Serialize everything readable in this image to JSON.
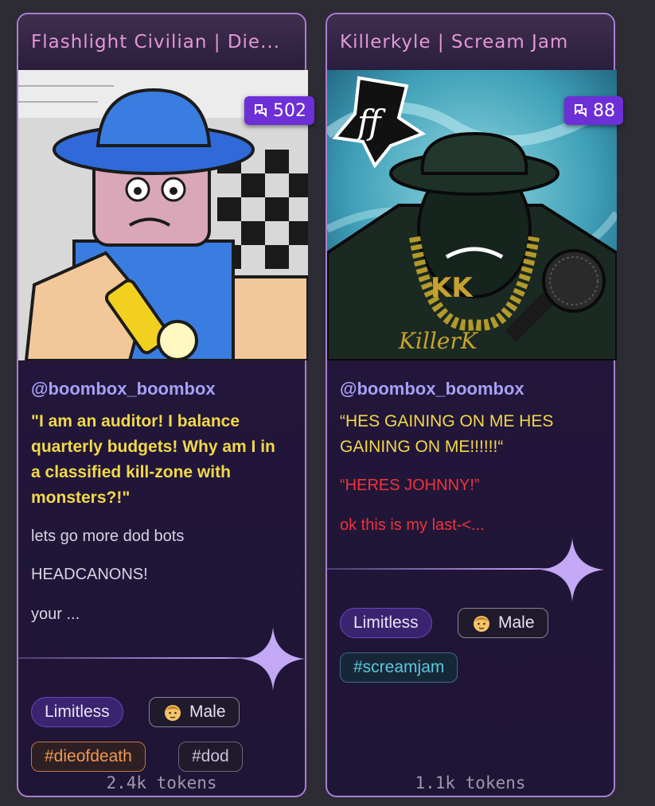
{
  "cards": [
    {
      "title": "Flashlight Civilian | Die...",
      "chat_count": "502",
      "author": "@boombox_boombox",
      "quote": "\"I am an auditor! I balance quarterly budgets! Why am I in a classified kill-zone with monsters?!\"",
      "lines": [
        "lets go more dod bots",
        "HEADCANONS!",
        "your ..."
      ],
      "tags": [
        "Limitless",
        "Male",
        "#dieofdeath",
        "#dod"
      ],
      "tokens": "2.4k tokens"
    },
    {
      "title": "Killerkyle | Scream Jam",
      "chat_count": "88",
      "author": "@boombox_boombox",
      "quote": "“HES GAINING ON ME HES GAINING ON ME!!!!!!“",
      "red_lines": [
        "“HERES JOHNNY!”",
        "ok this is my last-<..."
      ],
      "tags": [
        "Limitless",
        "Male",
        "#screamjam"
      ],
      "tokens": "1.1k tokens"
    }
  ],
  "colors": {
    "border": "#a87fd6",
    "title": "#e596d8",
    "badge": "#6d2fd6",
    "author": "#a89ff5",
    "quote_yellow": "#f2d84a",
    "red_text": "#f0343a"
  },
  "icons": [
    "chat-icon",
    "male-face-icon",
    "sparkle-icon"
  ]
}
